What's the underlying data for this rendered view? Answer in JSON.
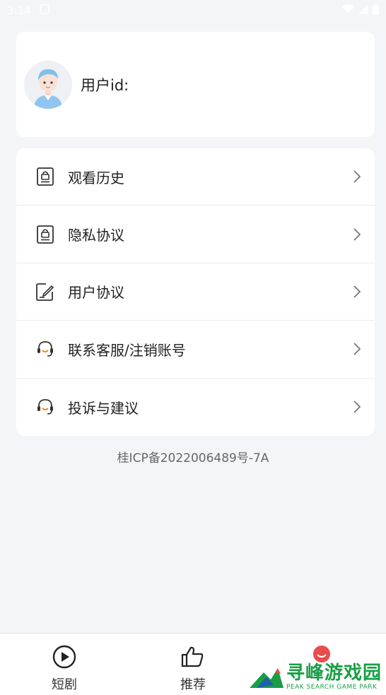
{
  "status_bar": {
    "time": "3:14"
  },
  "profile": {
    "label": "用户id:",
    "value": ""
  },
  "menu": {
    "items": [
      {
        "label": "观看历史",
        "icon": "lock-document-icon"
      },
      {
        "label": "隐私协议",
        "icon": "lock-document-icon"
      },
      {
        "label": "用户协议",
        "icon": "edit-document-icon"
      },
      {
        "label": "联系客服/注销账号",
        "icon": "headset-icon"
      },
      {
        "label": "投诉与建议",
        "icon": "headset-icon"
      }
    ]
  },
  "footer": {
    "icp": "桂ICP备2022006489号-7A"
  },
  "bottom_nav": {
    "tabs": [
      {
        "label": "短剧",
        "icon": "play-circle-icon"
      },
      {
        "label": "推荐",
        "icon": "thumbs-up-icon"
      },
      {
        "label": "",
        "icon": "profile-icon"
      }
    ]
  },
  "watermark": {
    "main": "寻峰游戏园",
    "sub": "PEAK SEARCH GAME PARK"
  },
  "colors": {
    "accent": "#e94c4c",
    "background": "#f4f5f8",
    "card": "#ffffff",
    "watermark": "#1a9e45"
  }
}
